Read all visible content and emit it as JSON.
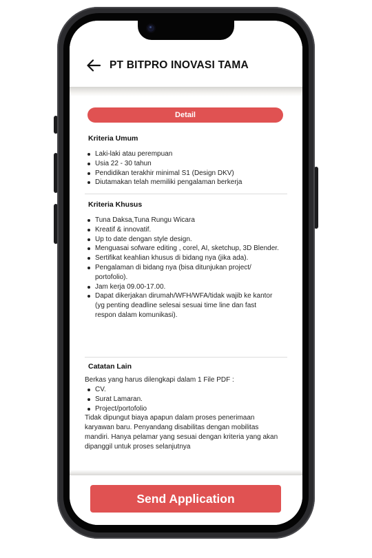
{
  "header": {
    "title": "PT BITPRO INOVASI TAMA"
  },
  "detail": {
    "label": "Detail"
  },
  "kriteria_umum": {
    "title": "Kriteria Umum",
    "items": [
      "Laki-laki atau perempuan",
      "Usia 22 - 30 tahun",
      "Pendidikan terakhir minimal S1 (Design DKV)",
      "Diutamakan telah memiliki pengalaman berkerja"
    ]
  },
  "kriteria_khusus": {
    "title": "Kriteria Khusus",
    "items": [
      "Tuna Daksa,Tuna Rungu Wicara",
      "Kreatif & innovatif.",
      "Up to date dengan style design.",
      "Menguasai sofware editing , corel, AI, sketchup, 3D Blender.",
      "Sertifikat keahlian khusus di bidang nya (jika ada).",
      "Pengalaman di bidang nya (bisa ditunjukan project/ portofolio).",
      "Jam kerja 09.00-17.00.",
      "Dapat dikerjakan dirumah/WFH/WFA/tidak wajib ke kantor (yg penting deadline selesai sesuai time line dan fast respon dalam komunikasi)."
    ]
  },
  "catatan_lain": {
    "title": "Catatan Lain",
    "intro": "Berkas yang harus dilengkapi dalam 1 File PDF :",
    "items": [
      "CV.",
      "Surat Lamaran.",
      "Project/portofolio"
    ],
    "note": "Tidak dipungut biaya apapun dalam proses penerimaan karyawan baru. Penyandang disabilitas dengan mobilitas mandiri. Hanya pelamar yang sesuai dengan kriteria yang akan dipanggil untuk proses selanjutnya"
  },
  "footer": {
    "send_label": "Send Application"
  },
  "colors": {
    "accent": "#e05252",
    "frame": "#2b2b2e"
  },
  "icons": {
    "back": "arrow-left-icon"
  }
}
